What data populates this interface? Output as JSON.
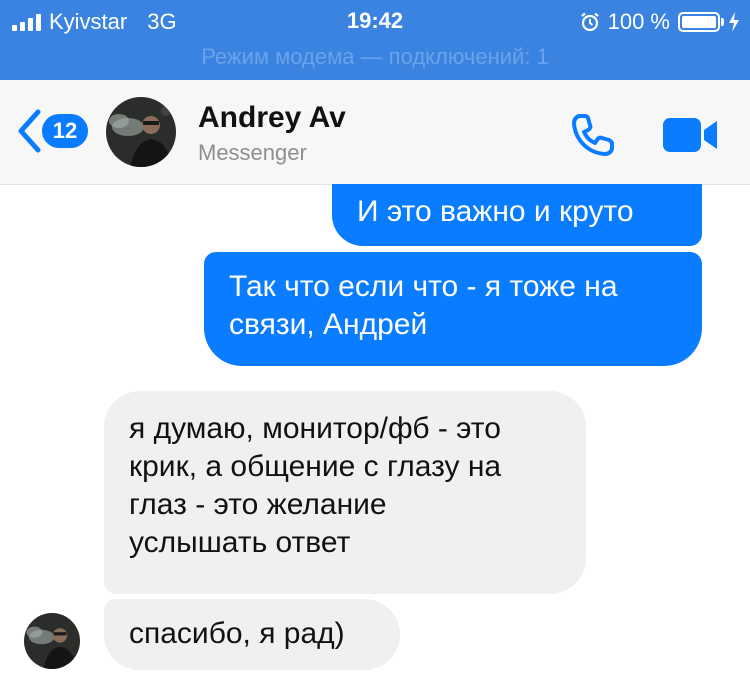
{
  "status_bar": {
    "carrier": "Kyivstar",
    "network": "3G",
    "time": "19:42",
    "battery": "100 %",
    "hotspot_text": "Режим модема — подключений: 1",
    "bar_color": "#3a83e0"
  },
  "header": {
    "back_badge": "12",
    "contact_name": "Andrey Av",
    "contact_subtitle": "Messenger",
    "accent_color": "#0a7cff"
  },
  "messages": [
    {
      "direction": "outgoing",
      "lines": [
        "И это важно и круто"
      ]
    },
    {
      "direction": "outgoing",
      "lines": [
        "Так что если что - я тоже на",
        "связи, Андрей"
      ]
    },
    {
      "direction": "incoming",
      "lines": [
        "я думаю, монитор/фб - это",
        "крик, а общение с глазу на",
        "глаз - это желание",
        "услышать ответ"
      ]
    },
    {
      "direction": "incoming",
      "lines": [
        "спасибо, я рад)"
      ]
    }
  ],
  "icons": {
    "back": "chevron-left-icon",
    "call": "phone-icon",
    "video": "video-camera-icon",
    "alarm": "alarm-icon",
    "charging": "bolt-icon"
  }
}
